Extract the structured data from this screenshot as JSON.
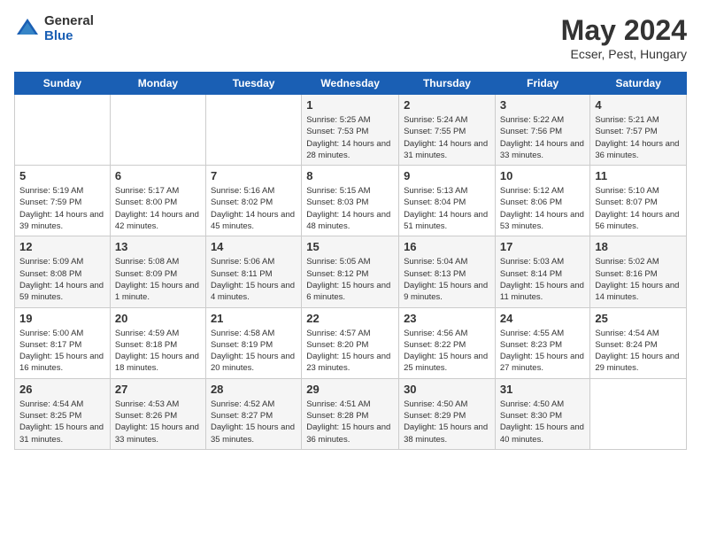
{
  "header": {
    "logo_general": "General",
    "logo_blue": "Blue",
    "month_year": "May 2024",
    "location": "Ecser, Pest, Hungary"
  },
  "calendar": {
    "days_of_week": [
      "Sunday",
      "Monday",
      "Tuesday",
      "Wednesday",
      "Thursday",
      "Friday",
      "Saturday"
    ],
    "weeks": [
      [
        {
          "day": "",
          "info": ""
        },
        {
          "day": "",
          "info": ""
        },
        {
          "day": "",
          "info": ""
        },
        {
          "day": "1",
          "info": "Sunrise: 5:25 AM\nSunset: 7:53 PM\nDaylight: 14 hours\nand 28 minutes."
        },
        {
          "day": "2",
          "info": "Sunrise: 5:24 AM\nSunset: 7:55 PM\nDaylight: 14 hours\nand 31 minutes."
        },
        {
          "day": "3",
          "info": "Sunrise: 5:22 AM\nSunset: 7:56 PM\nDaylight: 14 hours\nand 33 minutes."
        },
        {
          "day": "4",
          "info": "Sunrise: 5:21 AM\nSunset: 7:57 PM\nDaylight: 14 hours\nand 36 minutes."
        }
      ],
      [
        {
          "day": "5",
          "info": "Sunrise: 5:19 AM\nSunset: 7:59 PM\nDaylight: 14 hours\nand 39 minutes."
        },
        {
          "day": "6",
          "info": "Sunrise: 5:17 AM\nSunset: 8:00 PM\nDaylight: 14 hours\nand 42 minutes."
        },
        {
          "day": "7",
          "info": "Sunrise: 5:16 AM\nSunset: 8:02 PM\nDaylight: 14 hours\nand 45 minutes."
        },
        {
          "day": "8",
          "info": "Sunrise: 5:15 AM\nSunset: 8:03 PM\nDaylight: 14 hours\nand 48 minutes."
        },
        {
          "day": "9",
          "info": "Sunrise: 5:13 AM\nSunset: 8:04 PM\nDaylight: 14 hours\nand 51 minutes."
        },
        {
          "day": "10",
          "info": "Sunrise: 5:12 AM\nSunset: 8:06 PM\nDaylight: 14 hours\nand 53 minutes."
        },
        {
          "day": "11",
          "info": "Sunrise: 5:10 AM\nSunset: 8:07 PM\nDaylight: 14 hours\nand 56 minutes."
        }
      ],
      [
        {
          "day": "12",
          "info": "Sunrise: 5:09 AM\nSunset: 8:08 PM\nDaylight: 14 hours\nand 59 minutes."
        },
        {
          "day": "13",
          "info": "Sunrise: 5:08 AM\nSunset: 8:09 PM\nDaylight: 15 hours\nand 1 minute."
        },
        {
          "day": "14",
          "info": "Sunrise: 5:06 AM\nSunset: 8:11 PM\nDaylight: 15 hours\nand 4 minutes."
        },
        {
          "day": "15",
          "info": "Sunrise: 5:05 AM\nSunset: 8:12 PM\nDaylight: 15 hours\nand 6 minutes."
        },
        {
          "day": "16",
          "info": "Sunrise: 5:04 AM\nSunset: 8:13 PM\nDaylight: 15 hours\nand 9 minutes."
        },
        {
          "day": "17",
          "info": "Sunrise: 5:03 AM\nSunset: 8:14 PM\nDaylight: 15 hours\nand 11 minutes."
        },
        {
          "day": "18",
          "info": "Sunrise: 5:02 AM\nSunset: 8:16 PM\nDaylight: 15 hours\nand 14 minutes."
        }
      ],
      [
        {
          "day": "19",
          "info": "Sunrise: 5:00 AM\nSunset: 8:17 PM\nDaylight: 15 hours\nand 16 minutes."
        },
        {
          "day": "20",
          "info": "Sunrise: 4:59 AM\nSunset: 8:18 PM\nDaylight: 15 hours\nand 18 minutes."
        },
        {
          "day": "21",
          "info": "Sunrise: 4:58 AM\nSunset: 8:19 PM\nDaylight: 15 hours\nand 20 minutes."
        },
        {
          "day": "22",
          "info": "Sunrise: 4:57 AM\nSunset: 8:20 PM\nDaylight: 15 hours\nand 23 minutes."
        },
        {
          "day": "23",
          "info": "Sunrise: 4:56 AM\nSunset: 8:22 PM\nDaylight: 15 hours\nand 25 minutes."
        },
        {
          "day": "24",
          "info": "Sunrise: 4:55 AM\nSunset: 8:23 PM\nDaylight: 15 hours\nand 27 minutes."
        },
        {
          "day": "25",
          "info": "Sunrise: 4:54 AM\nSunset: 8:24 PM\nDaylight: 15 hours\nand 29 minutes."
        }
      ],
      [
        {
          "day": "26",
          "info": "Sunrise: 4:54 AM\nSunset: 8:25 PM\nDaylight: 15 hours\nand 31 minutes."
        },
        {
          "day": "27",
          "info": "Sunrise: 4:53 AM\nSunset: 8:26 PM\nDaylight: 15 hours\nand 33 minutes."
        },
        {
          "day": "28",
          "info": "Sunrise: 4:52 AM\nSunset: 8:27 PM\nDaylight: 15 hours\nand 35 minutes."
        },
        {
          "day": "29",
          "info": "Sunrise: 4:51 AM\nSunset: 8:28 PM\nDaylight: 15 hours\nand 36 minutes."
        },
        {
          "day": "30",
          "info": "Sunrise: 4:50 AM\nSunset: 8:29 PM\nDaylight: 15 hours\nand 38 minutes."
        },
        {
          "day": "31",
          "info": "Sunrise: 4:50 AM\nSunset: 8:30 PM\nDaylight: 15 hours\nand 40 minutes."
        },
        {
          "day": "",
          "info": ""
        }
      ]
    ]
  }
}
